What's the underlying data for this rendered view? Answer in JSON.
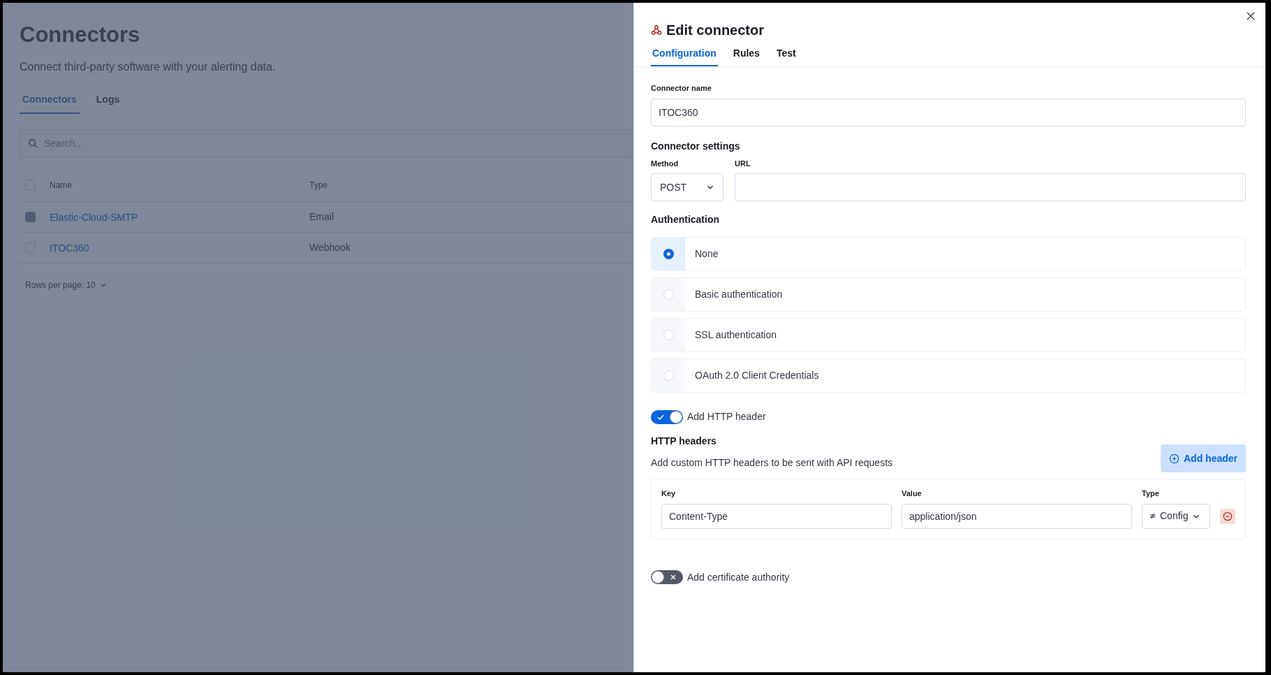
{
  "page": {
    "title": "Connectors",
    "subtitle": "Connect third-party software with your alerting data.",
    "tabs": [
      {
        "label": "Connectors",
        "selected": true
      },
      {
        "label": "Logs",
        "selected": false
      }
    ],
    "search": {
      "placeholder": "Search..."
    },
    "table": {
      "columns": [
        "Name",
        "Type"
      ],
      "select_all": {
        "checked": false
      },
      "rows": [
        {
          "name": "Elastic-Cloud-SMTP",
          "type": "Email",
          "disabled": true
        },
        {
          "name": "ITOC360",
          "type": "Webhook",
          "disabled": false
        }
      ]
    },
    "pagination": {
      "label": "Rows per page: 10"
    }
  },
  "panel": {
    "title": "Edit connector",
    "tabs": [
      {
        "label": "Configuration",
        "selected": true
      },
      {
        "label": "Rules",
        "selected": false
      },
      {
        "label": "Test",
        "selected": false
      }
    ],
    "connector_name": {
      "label": "Connector name",
      "value": "ITOC360"
    },
    "settings": {
      "heading": "Connector settings",
      "method_label": "Method",
      "method": "POST",
      "url_label": "URL"
    },
    "authentication": {
      "heading": "Authentication",
      "options": [
        {
          "label": "None",
          "selected": true
        },
        {
          "label": "Basic authentication",
          "selected": false
        },
        {
          "label": "SSL authentication",
          "selected": false
        },
        {
          "label": "OAuth 2.0 Client Credentials",
          "selected": false
        }
      ]
    },
    "http_header_toggle": {
      "label": "Add HTTP header",
      "on": true
    },
    "http_headers": {
      "heading": "HTTP headers",
      "description": "Add custom HTTP headers to be sent with API requests",
      "add_button": "Add header",
      "columns": [
        "Key",
        "Value",
        "Type"
      ],
      "rows": [
        {
          "key": "Content-Type",
          "value": "application/json",
          "type": "Config"
        }
      ]
    },
    "certificate_toggle": {
      "label": "Add certificate authority",
      "on": false
    }
  }
}
